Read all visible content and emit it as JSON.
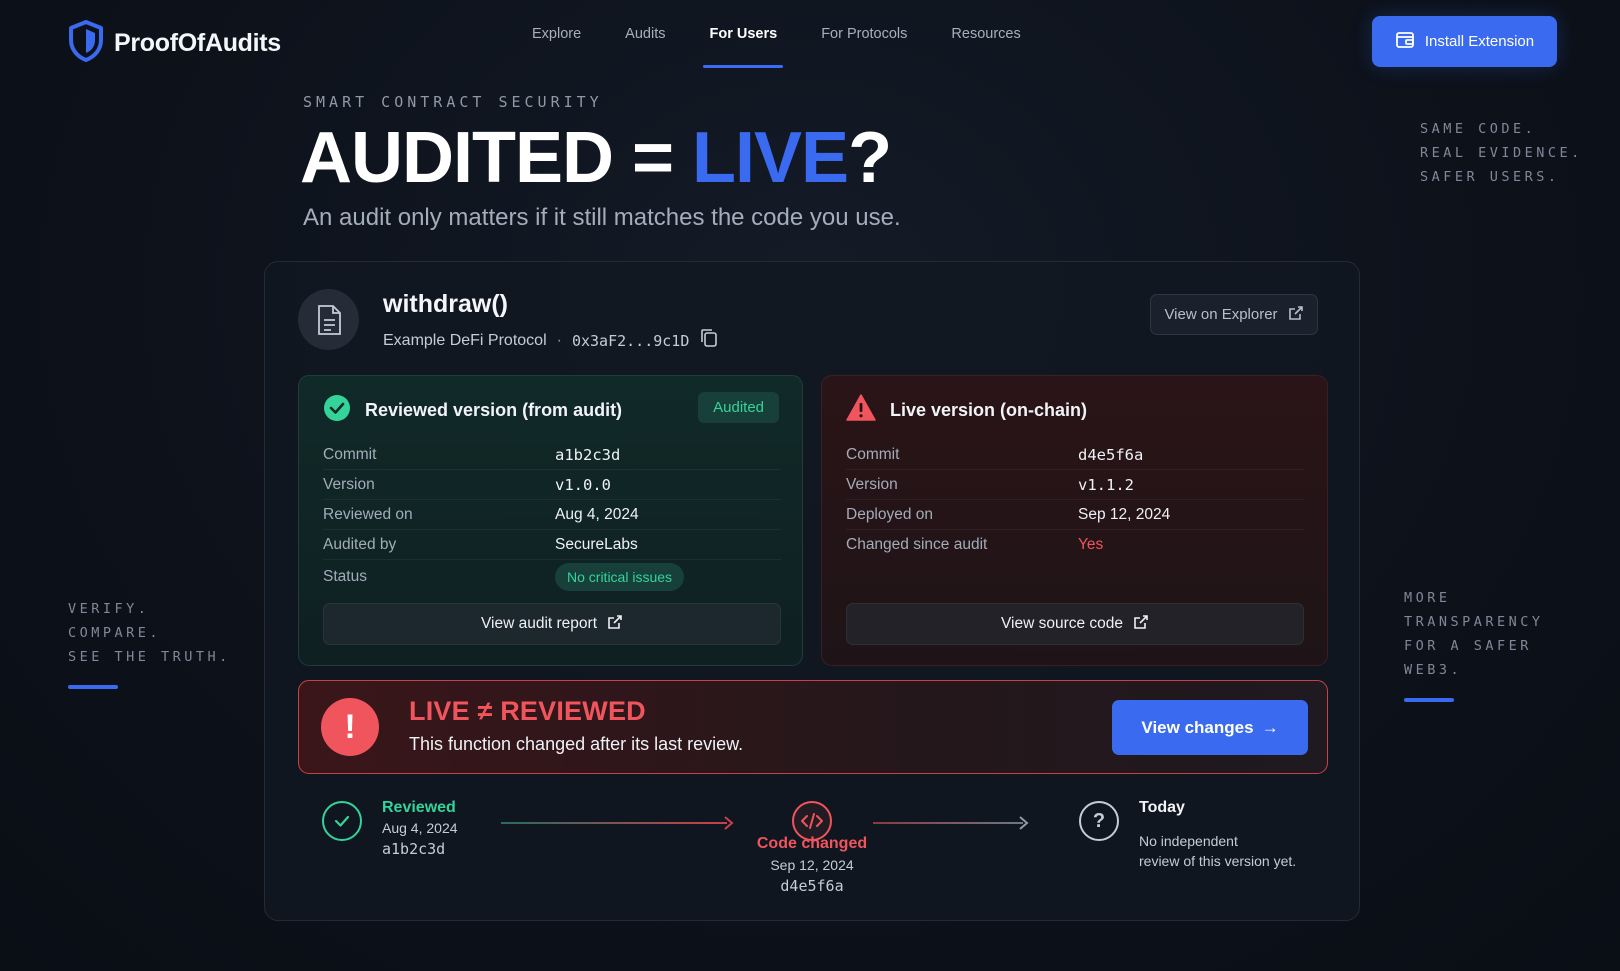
{
  "brand": {
    "name": "ProofOfAudits"
  },
  "nav": {
    "links": [
      "Explore",
      "Audits",
      "For Users",
      "For Protocols",
      "Resources"
    ],
    "active": "For Users",
    "install_label": "Install Extension"
  },
  "hero": {
    "eyebrow": "SMART CONTRACT SECURITY",
    "title_part1": "AUDITED = ",
    "title_accent": "LIVE",
    "title_part2": "?",
    "subtitle": "An audit only matters if it still matches the code you use."
  },
  "side_right_top": [
    "SAME CODE.",
    "REAL EVIDENCE.",
    "SAFER USERS."
  ],
  "side_left": [
    "VERIFY.",
    "COMPARE.",
    "SEE THE TRUTH."
  ],
  "side_right_bottom": [
    "MORE",
    "TRANSPARENCY",
    "FOR A SAFER",
    "WEB3."
  ],
  "function": {
    "name": "withdraw()",
    "protocol": "Example DeFi Protocol",
    "separator": "·",
    "address": "0x3aF2...9c1D",
    "explorer_label": "View on Explorer"
  },
  "reviewed": {
    "title": "Reviewed version (from audit)",
    "badge": "Audited",
    "rows": [
      {
        "k": "Commit",
        "v": "a1b2c3d"
      },
      {
        "k": "Version",
        "v": "v1.0.0"
      },
      {
        "k": "Reviewed on",
        "v": "Aug 4, 2024"
      },
      {
        "k": "Audited by",
        "v": "SecureLabs"
      }
    ],
    "status_label": "Status",
    "status_value": "No critical issues",
    "button_label": "View audit report"
  },
  "live": {
    "title": "Live version (on-chain)",
    "rows": [
      {
        "k": "Commit",
        "v": "d4e5f6a"
      },
      {
        "k": "Version",
        "v": "v1.1.2"
      },
      {
        "k": "Deployed on",
        "v": "Sep 12, 2024"
      }
    ],
    "changed_label": "Changed since audit",
    "changed_value": "Yes",
    "button_label": "View source code"
  },
  "alert": {
    "title": "LIVE ≠ REVIEWED",
    "subtitle": "This function changed after its last review.",
    "button_label": "View changes",
    "arrow": "→"
  },
  "timeline": {
    "reviewed": {
      "title": "Reviewed",
      "date": "Aug 4, 2024",
      "hash": "a1b2c3d"
    },
    "changed": {
      "title": "Code changed",
      "date": "Sep 12, 2024",
      "hash": "d4e5f6a"
    },
    "today": {
      "title": "Today",
      "note_line1": "No independent",
      "note_line2": "review of this version yet."
    }
  },
  "colors": {
    "accent": "#3a6af0",
    "success": "#34d399",
    "danger": "#f0545c",
    "background": "#0d121b"
  },
  "icons": [
    "shield-logo-icon",
    "wallet-icon",
    "file-code-icon",
    "copy-icon",
    "external-link-icon",
    "check-circle-icon",
    "warning-triangle-icon",
    "exclamation-icon",
    "arrow-right-icon",
    "code-icon",
    "question-icon"
  ]
}
